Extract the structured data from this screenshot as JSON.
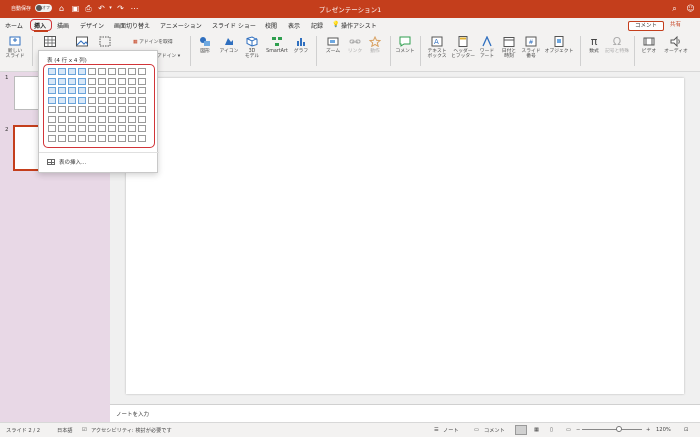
{
  "titlebar": {
    "autosave_label": "自動保存",
    "autosave_state": "オフ",
    "title": "プレゼンテーション1",
    "color": "#c43e1c"
  },
  "tabs": [
    {
      "label": "ホーム"
    },
    {
      "label": "挿入",
      "active": true
    },
    {
      "label": "描画"
    },
    {
      "label": "デザイン"
    },
    {
      "label": "画面切り替え"
    },
    {
      "label": "アニメーション"
    },
    {
      "label": "スライド ショー"
    },
    {
      "label": "校閲"
    },
    {
      "label": "表示"
    },
    {
      "label": "記録"
    },
    {
      "label": "操作アシスト"
    }
  ],
  "header_buttons": {
    "comment": "コメント",
    "share": "共有"
  },
  "ribbon": {
    "new_slide": "新しい\nスライド",
    "addin_get": "アドインを取得",
    "addin": "アドイン",
    "shapes": "図形",
    "icons": "アイコン",
    "model_3d": "3D\nモデル",
    "smartart": "SmartArt",
    "graph": "グラフ",
    "zoom": "ズーム",
    "link": "リンク",
    "action": "動作",
    "comment": "コメント",
    "textbox": "テキスト\nボックス",
    "header_footer": "ヘッダー\nとフッター",
    "wordart": "ワード\nアート",
    "datetime": "日付と\n時刻",
    "slide_number": "スライド\n番号",
    "object": "オブジェクト",
    "equation": "数式",
    "symbol": "記号と特殊",
    "video": "ビデオ",
    "audio": "オーディオ"
  },
  "table_dropdown": {
    "title": "表 (4 行 x 4 列)",
    "rows": 8,
    "cols": 10,
    "highlight_rows": 4,
    "highlight_cols": 4,
    "insert_label": "表の挿入..."
  },
  "slides": [
    {
      "number": "1"
    },
    {
      "number": "2",
      "selected": true
    }
  ],
  "notes_placeholder": "ノートを入力",
  "statusbar": {
    "slide_pos": "スライド 2 / 2",
    "language": "日本語",
    "accessibility": "アクセシビリティ: 検討が必要です",
    "notes": "ノート",
    "comments": "コメント",
    "zoom": "120%"
  }
}
